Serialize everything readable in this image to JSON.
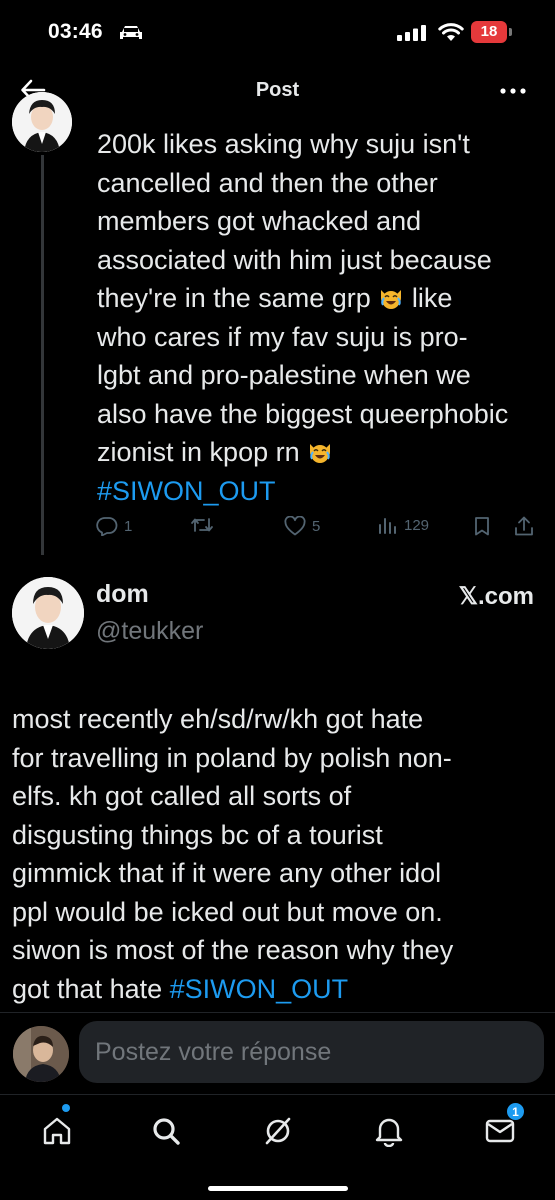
{
  "status_bar": {
    "time": "03:46",
    "battery": "18"
  },
  "header": {
    "title": "Post"
  },
  "tweet1": {
    "lines": [
      "200k likes asking why suju isn't",
      "cancelled and then the other",
      "members got whacked and",
      "associated with him just because",
      "they're in the same grp",
      "like",
      "who cares if my fav suju is pro-",
      "lgbt and pro-palestine when we",
      "also have the biggest queerphobic",
      "zionist in kpop rn"
    ],
    "hashtag": "#SIWON_OUT",
    "reply_count": "1",
    "like_count": "5",
    "view_count": "129"
  },
  "tweet2": {
    "author_name": "dom",
    "handle": "@teukker",
    "source": "𝕏.com",
    "lines": [
      "most recently eh/sd/rw/kh got hate",
      "for travelling in poland by polish non-",
      "elfs. kh got called all sorts of",
      "disgusting things bc of a tourist",
      "gimmick that if it were any other idol",
      "ppl would be icked out but move on.",
      "siwon is most of the reason why they",
      "got that hate"
    ],
    "hashtag": "#SIWON_OUT"
  },
  "reply": {
    "placeholder": "Postez votre réponse"
  },
  "tabbar": {
    "messages_badge": "1"
  },
  "colors": {
    "accent": "#1d9bf0",
    "background": "#000000",
    "muted": "#71767b",
    "battery": "#e5393b"
  },
  "icons": [
    "car-icon",
    "signal-icon",
    "wifi-icon",
    "back-icon",
    "more-icon",
    "reply-icon",
    "retweet-icon",
    "like-icon",
    "views-icon",
    "bookmark-icon",
    "share-icon",
    "home-icon",
    "search-icon",
    "grok-icon",
    "bell-icon",
    "mail-icon"
  ]
}
